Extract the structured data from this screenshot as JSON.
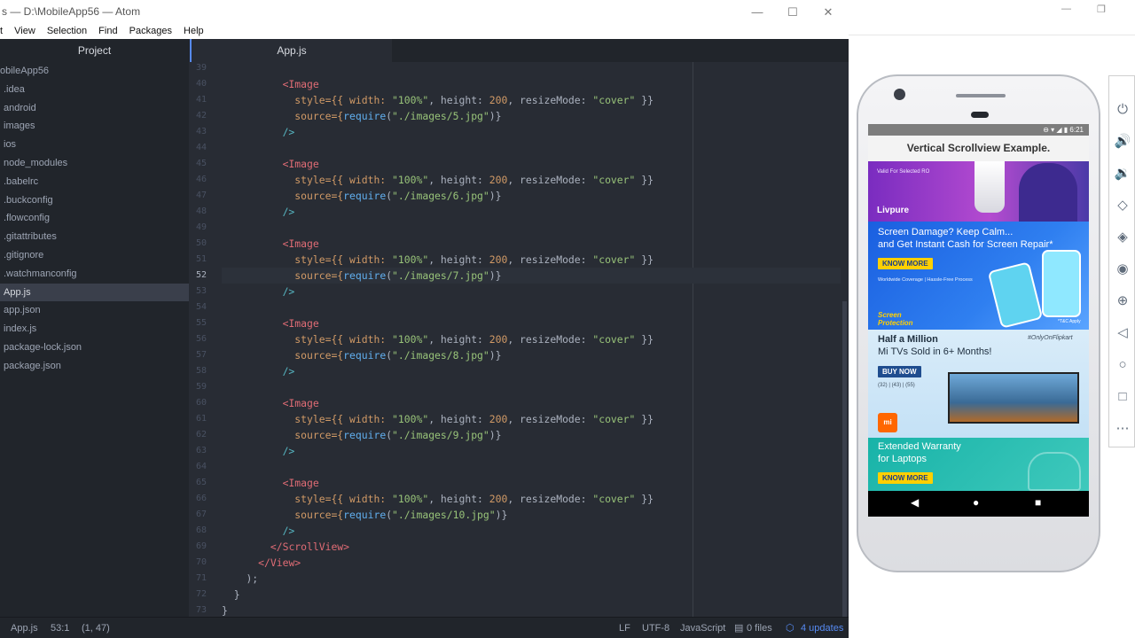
{
  "atom": {
    "title": "s — D:\\MobileApp56 — Atom",
    "window_controls": {
      "minimize": "—",
      "maximize": "☐",
      "close": "✕"
    },
    "menu": [
      "View",
      "Selection",
      "Find",
      "Packages",
      "Help"
    ],
    "menu_first_partial": "t",
    "project_tab": "Project",
    "file_tab": "App.js",
    "tree": {
      "root": "obileApp56",
      "items": [
        ".idea",
        "android",
        "images",
        "ios",
        "node_modules",
        ".babelrc",
        ".buckconfig",
        ".flowconfig",
        ".gitattributes",
        ".gitignore",
        ".watchmanconfig",
        "App.js",
        "app.json",
        "index.js",
        "package-lock.json",
        "package.json"
      ],
      "selected": "App.js"
    },
    "editor": {
      "line_numbers": [
        "39",
        "40",
        "41",
        "42",
        "43",
        "44",
        "45",
        "46",
        "47",
        "48",
        "49",
        "50",
        "51",
        "52",
        "53",
        "54",
        "55",
        "56",
        "57",
        "58",
        "59",
        "60",
        "61",
        "62",
        "63",
        "64",
        "65",
        "66",
        "67",
        "68",
        "69",
        "70",
        "71",
        "72",
        "73"
      ],
      "current_line": "52",
      "images": [
        "./images/5.jpg",
        "./images/6.jpg",
        "./images/7.jpg",
        "./images/8.jpg",
        "./images/9.jpg",
        "./images/10.jpg"
      ],
      "image_tag": "<Image",
      "style_attr": "style={{ width: ",
      "width_val": "\"100%\"",
      "height_key": ", height: ",
      "height_val": "200",
      "resize_key": ", resizeMode: ",
      "resize_val": "\"cover\"",
      "style_close": " }}",
      "source_attr": "source={",
      "require_fn": "require",
      "self_close": "/>",
      "scrollview_close": "</ScrollView>",
      "view_close": "</View>",
      "paren_close": ");",
      "brace_close_inner": "}",
      "brace_close_outer": "}"
    },
    "status": {
      "file": "App.js",
      "cursor": "53:1",
      "selection": "(1, 47)",
      "line_ending": "LF",
      "encoding": "UTF-8",
      "grammar": "JavaScript",
      "files": "0 files",
      "updates": "4 updates"
    }
  },
  "emulator": {
    "window_controls": {
      "minimize": "—",
      "maximize": "❐",
      "close": "✕"
    },
    "status_time": "6:21",
    "app_title": "Vertical Scrollview Example.",
    "banners": {
      "b1": {
        "small": "Valid For Selected RO",
        "brand": "Livpure"
      },
      "b2": {
        "headline1": "Screen Damage? Keep Calm...",
        "headline2": "and Get Instant Cash for Screen Repair*",
        "button": "KNOW MORE",
        "sub": "Worldwide Coverage | Hassle-Free Process",
        "logo1": "Screen",
        "logo2": "Protection",
        "tc": "*T&C Apply"
      },
      "b3": {
        "headline1": "Half a Million",
        "headline2": "Mi TVs Sold in 6+ Months!",
        "button": "BUY NOW",
        "sizes": "(32) | (43) | (55)",
        "tag": "#OnlyOnFlipkart",
        "logo": "mi"
      },
      "b4": {
        "headline1": "Extended Warranty",
        "headline2": "for Laptops",
        "button": "KNOW MORE"
      }
    },
    "nav": {
      "back": "◀",
      "home": "●",
      "recent": "■"
    }
  },
  "colors": {
    "editor_bg": "#282c34",
    "panel_bg": "#21252b",
    "accent": "#568af2",
    "tag": "#e06c75",
    "attr": "#d19a66",
    "string": "#98c379",
    "function": "#61afef"
  }
}
